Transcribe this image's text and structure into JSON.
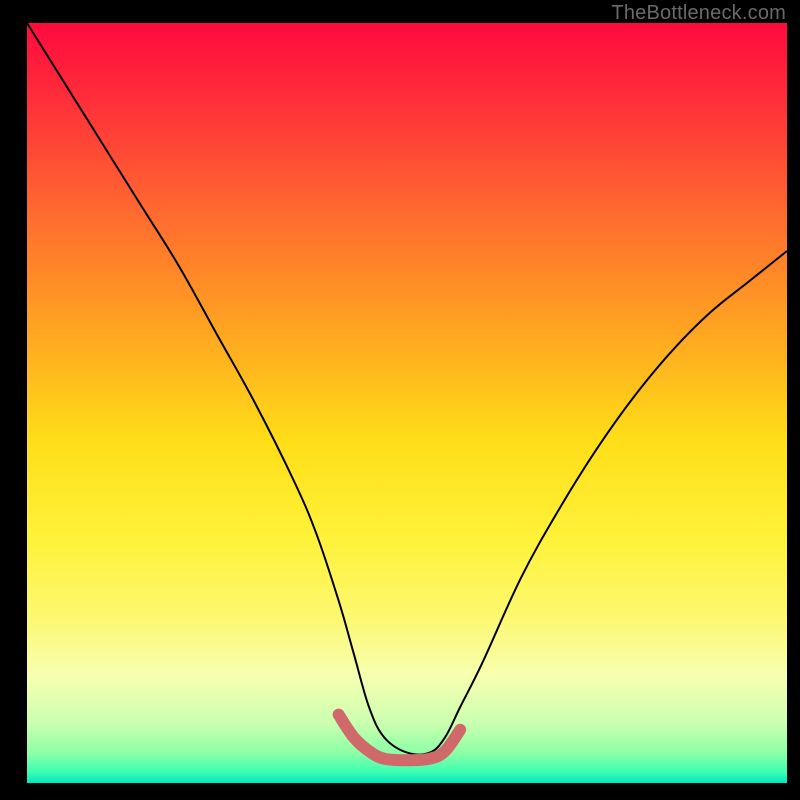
{
  "watermark": "TheBottleneck.com",
  "chart_data": {
    "type": "line",
    "title": "",
    "xlabel": "",
    "ylabel": "",
    "xlim": [
      0,
      100
    ],
    "ylim": [
      0,
      100
    ],
    "gradient_stops": [
      {
        "offset": 0,
        "color": "#ff0a3e"
      },
      {
        "offset": 0.1,
        "color": "#ff2e3a"
      },
      {
        "offset": 0.25,
        "color": "#ff6a2f"
      },
      {
        "offset": 0.4,
        "color": "#ffa321"
      },
      {
        "offset": 0.55,
        "color": "#ffde18"
      },
      {
        "offset": 0.68,
        "color": "#fff23a"
      },
      {
        "offset": 0.78,
        "color": "#fcf86f"
      },
      {
        "offset": 0.86,
        "color": "#f7ffb1"
      },
      {
        "offset": 0.92,
        "color": "#ccffb0"
      },
      {
        "offset": 0.96,
        "color": "#8dffa6"
      },
      {
        "offset": 0.985,
        "color": "#3effb2"
      },
      {
        "offset": 1.0,
        "color": "#00e6c0"
      }
    ],
    "series": [
      {
        "name": "curve",
        "stroke": "#000000",
        "stroke_width": 2,
        "x": [
          0,
          5,
          10,
          15,
          20,
          25,
          30,
          35,
          38,
          41,
          43,
          45,
          47,
          50,
          53,
          55,
          57,
          60,
          65,
          70,
          75,
          80,
          85,
          90,
          95,
          100
        ],
        "y": [
          100,
          92,
          84,
          76,
          68,
          59,
          50,
          40,
          33,
          24,
          17,
          10,
          6,
          4,
          4,
          6,
          10,
          16,
          27,
          36,
          44,
          51,
          57,
          62,
          66,
          70
        ]
      },
      {
        "name": "valley-highlight",
        "stroke": "#d06a6a",
        "stroke_width": 12,
        "linecap": "round",
        "x": [
          41,
          43,
          45,
          47,
          50,
          53,
          55,
          57
        ],
        "y": [
          9,
          6,
          4.2,
          3.2,
          3,
          3.2,
          4.2,
          7
        ]
      }
    ]
  }
}
